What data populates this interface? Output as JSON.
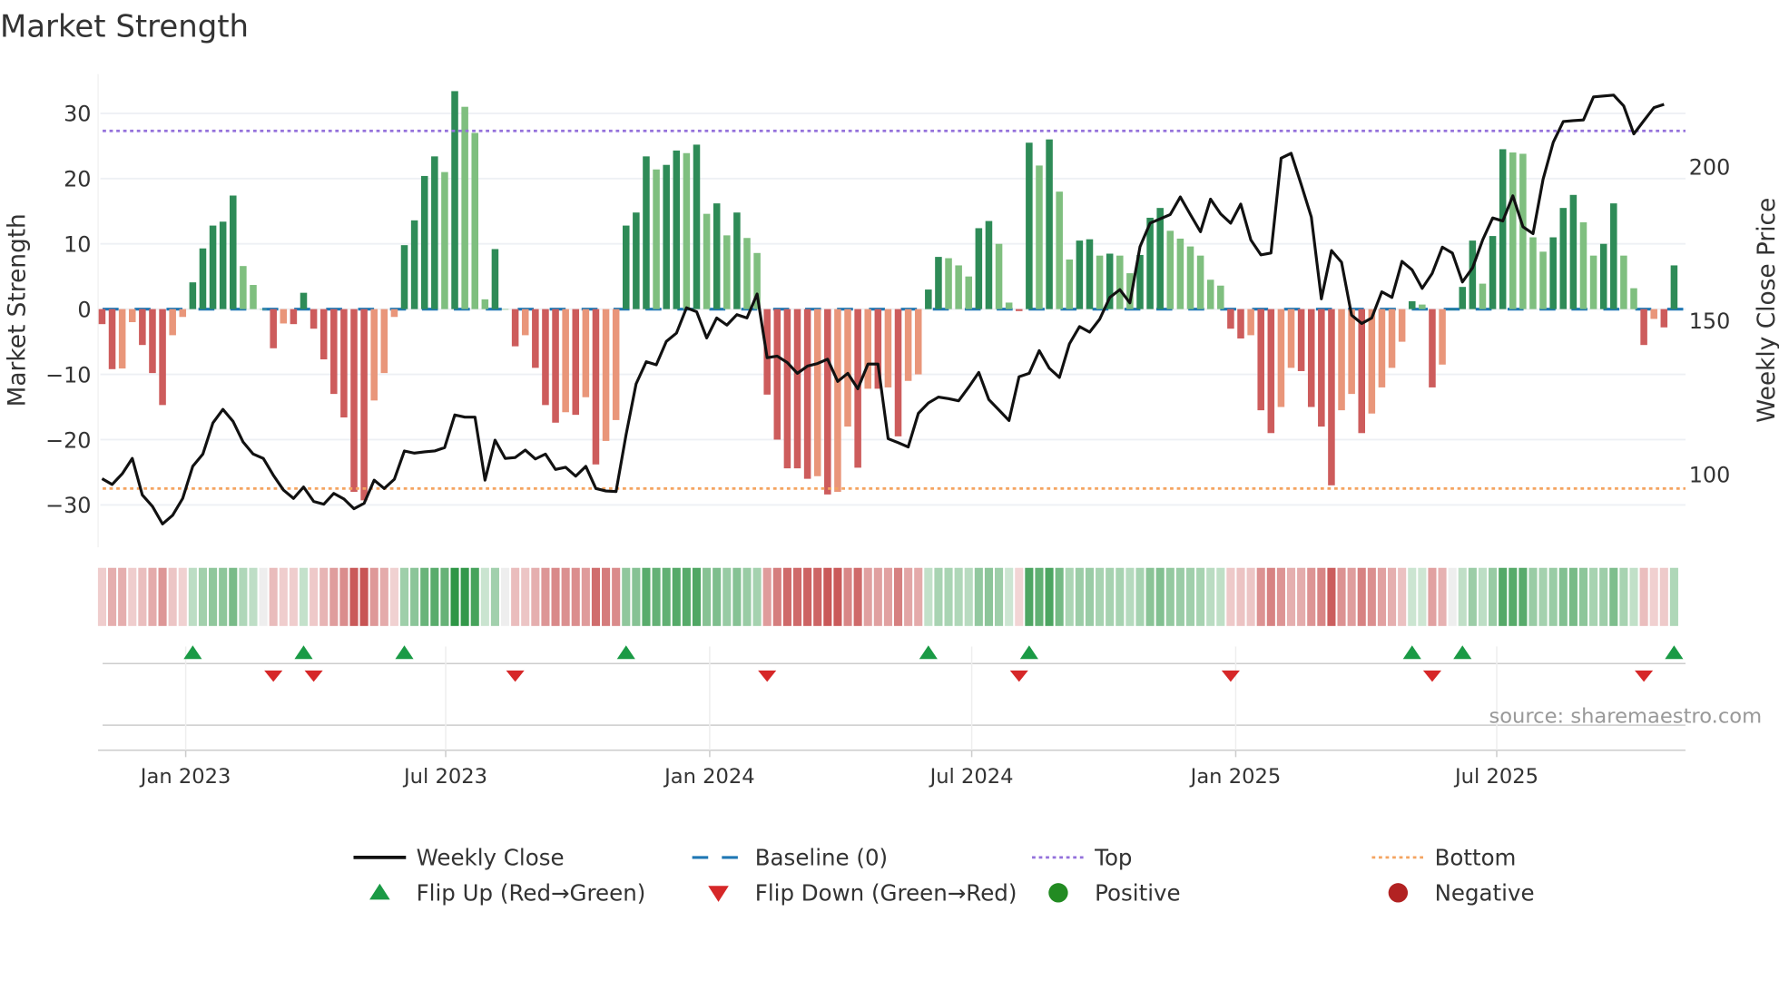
{
  "chart_data": {
    "type": "bar",
    "title": "Market Strength",
    "ylabel": "Market Strength",
    "y2label": "Weekly Close Price",
    "ylim": [
      -36.5,
      36
    ],
    "y2lim": [
      76.3,
      230
    ],
    "yticks": [
      30,
      20,
      10,
      0,
      -10,
      -20,
      -30
    ],
    "ytick_labels": [
      "30",
      "20",
      "10",
      "0",
      "−10",
      "−20",
      "−30"
    ],
    "y2ticks": [
      200,
      150,
      100
    ],
    "y2tick_labels": [
      "200",
      "150",
      "100"
    ],
    "xticks": [
      {
        "label": "Jan 2023",
        "week": 8.3
      },
      {
        "label": "Jul 2023",
        "week": 34.1
      },
      {
        "label": "Jan 2024",
        "week": 60.3
      },
      {
        "label": "Jul 2024",
        "week": 86.3
      },
      {
        "label": "Jan 2025",
        "week": 112.5
      },
      {
        "label": "Jul 2025",
        "week": 138.4
      }
    ],
    "top_level": 27.3,
    "bottom_level": -27.5,
    "baseline": 0,
    "grid": true,
    "strength": [
      -2.3,
      -9.2,
      -9.1,
      -2,
      -5.5,
      -9.8,
      -14.7,
      -4,
      -1.2,
      4.1,
      9.3,
      12.8,
      13.4,
      17.4,
      6.6,
      3.7,
      0,
      -6,
      -2.2,
      -2.3,
      2.5,
      -3,
      -7.7,
      -13,
      -16.6,
      -28,
      -29.3,
      -14,
      -9.8,
      -1.2,
      9.8,
      13.6,
      20.4,
      23.4,
      21,
      33.4,
      31,
      27,
      1.5,
      9.2,
      0,
      -5.7,
      -4,
      -9,
      -14.7,
      -17.4,
      -15.8,
      -16.2,
      -13.5,
      -23.8,
      -20.2,
      -17,
      12.8,
      14.8,
      23.4,
      21.4,
      22.1,
      24.3,
      23.9,
      25.2,
      14.6,
      16.2,
      11.3,
      14.8,
      10.9,
      8.6,
      -13.1,
      -20,
      -24.4,
      -24.4,
      -26,
      -25.6,
      -28.4,
      -28,
      -18,
      -24.3,
      -12.2,
      -12.2,
      -12,
      -19.5,
      -11,
      -10,
      3,
      8,
      7.8,
      6.7,
      5,
      12.4,
      13.5,
      10,
      1,
      -0.3,
      25.5,
      22,
      26,
      18,
      7.6,
      10.5,
      10.7,
      8.2,
      8.5,
      8.2,
      5.5,
      8.3,
      14,
      15.5,
      12,
      10.8,
      9.6,
      8.2,
      4.5,
      3.6,
      -3,
      -4.5,
      -4,
      -15.5,
      -19,
      -15,
      -9,
      -9.5,
      -15,
      -18,
      -27,
      -15.5,
      -13,
      -19,
      -16,
      -12,
      -9,
      -5,
      1.2,
      0.7,
      -12,
      -8.5,
      0,
      3.4,
      10.5,
      3.9,
      11.2,
      24.5,
      24,
      23.8,
      11,
      8.8,
      11,
      15.5,
      17.5,
      13.3,
      8.2,
      10,
      16.2,
      8.2,
      3.2,
      -5.5,
      -1.5,
      -2.8,
      6.7
    ],
    "weekly_close": [
      98.6,
      96.7,
      100.2,
      105.2,
      93.3,
      89.6,
      83.9,
      86.7,
      92.2,
      102.6,
      106.6,
      116.7,
      121.1,
      117.2,
      110.5,
      106.6,
      105.2,
      99.7,
      94.9,
      92.2,
      95.9,
      91.2,
      90.3,
      93.8,
      92.0,
      88.8,
      90.6,
      98.1,
      95.4,
      98.4,
      107.6,
      106.9,
      107.3,
      107.6,
      108.7,
      119.3,
      118.6,
      118.6,
      98.1,
      111.1,
      105.2,
      105.5,
      107.9,
      105.0,
      106.6,
      101.6,
      102.3,
      99.4,
      102.6,
      95.4,
      94.6,
      94.4,
      112.9,
      129.4,
      136.6,
      135.6,
      143.2,
      145.9,
      154.1,
      152.8,
      144.3,
      150.8,
      148.5,
      151.9,
      150.8,
      158.6,
      137.9,
      138.4,
      136.3,
      132.8,
      135.2,
      136.0,
      137.4,
      130.2,
      132.8,
      127.8,
      135.8,
      135.8,
      111.6,
      110.3,
      108.9,
      119.8,
      123.2,
      125.1,
      124.6,
      123.9,
      128.3,
      133.1,
      124.3,
      120.9,
      117.5,
      131.7,
      132.8,
      140.2,
      134.5,
      131.5,
      142.4,
      148.0,
      146.2,
      150.4,
      157.5,
      160.0,
      155.7,
      174.0,
      181.6,
      183.0,
      184.4,
      190.1,
      184.4,
      178.8,
      189.4,
      184.6,
      181.6,
      187.8,
      176.1,
      171.3,
      171.9,
      202.7,
      204.3,
      194.2,
      183.6,
      157.0,
      172.7,
      168.9,
      151.7,
      149.0,
      150.8,
      159.3,
      157.5,
      169.2,
      166.4,
      160.4,
      165.3,
      173.8,
      171.9,
      162.5,
      167.1,
      176.1,
      183.3,
      182.3,
      190.5,
      180.4,
      178.2,
      195.8,
      207.8,
      214.6,
      214.9,
      215.1,
      222.6,
      222.9,
      223.2,
      219.7,
      210.6,
      214.9,
      219.1,
      220.2
    ],
    "legend": {
      "placement": "bottom",
      "items": [
        {
          "label": "Weekly Close",
          "marker": "line"
        },
        {
          "label": "Baseline (0)",
          "marker": "dashed-line"
        },
        {
          "label": "Top",
          "marker": "dotted-line"
        },
        {
          "label": "Bottom",
          "marker": "dotted-line"
        },
        {
          "label": "Flip Up (Red→Green)",
          "marker": "triangle-up"
        },
        {
          "label": "Flip Down (Green→Red)",
          "marker": "triangle-down"
        },
        {
          "label": "Positive",
          "marker": "circle"
        },
        {
          "label": "Negative",
          "marker": "circle"
        }
      ]
    },
    "source": "source: sharemaestro.com"
  },
  "colors": {
    "pos_rising": "#2e8b57",
    "pos_falling": "#7fbf7f",
    "neg_falling": "#cd5c5c",
    "neg_rising": "#e9967a",
    "price": "#111111",
    "baseline": "#1f77b4",
    "top": "#9370db",
    "bottom": "#f4a460",
    "flip_up": "#1a9a45",
    "flip_down": "#d62728",
    "positive": "#228b22",
    "negative": "#b22222"
  }
}
